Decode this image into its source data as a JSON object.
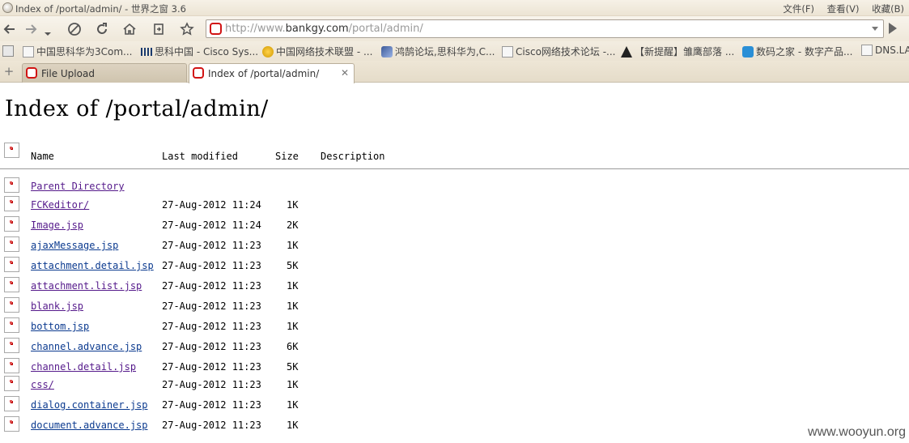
{
  "window": {
    "title": "Index of /portal/admin/ - 世界之窗 3.6",
    "menus": [
      "文件(F)",
      "查看(V)",
      "收藏(B)"
    ]
  },
  "toolbar": {
    "url_prefix": "http://www.",
    "url_domain": "bankgy.com",
    "url_path": "/portal/admin/"
  },
  "bookmarks": [
    {
      "label": "中国思科华为3Com...",
      "icon": "page"
    },
    {
      "label": "思科中国 - Cisco Sys...",
      "icon": "cisco"
    },
    {
      "label": "中国网络技术联盟 - ...",
      "icon": "trophy"
    },
    {
      "label": "鸿鹄论坛,思科华为,C...",
      "icon": "bird"
    },
    {
      "label": "Cisco网络技术论坛 -...",
      "icon": "page"
    },
    {
      "label": "【新提醒】雏鹰部落 ...",
      "icon": "boat"
    },
    {
      "label": "数码之家 - 数字产品...",
      "icon": "home"
    },
    {
      "label": "DNS.LA",
      "icon": "page"
    }
  ],
  "tabs": [
    {
      "label": "File Upload",
      "active": false
    },
    {
      "label": "Index of /portal/admin/",
      "active": true
    }
  ],
  "page": {
    "title": "Index of /portal/admin/",
    "columns": {
      "name": "Name",
      "modified": "Last modified",
      "size": "Size",
      "description": "Description"
    },
    "parent_label": "Parent Directory",
    "files": [
      {
        "name": "FCKeditor/",
        "modified": "27-Aug-2012 11:24",
        "size": "1K"
      },
      {
        "name": "Image.jsp",
        "modified": "27-Aug-2012 11:24",
        "size": "2K"
      },
      {
        "name": "ajaxMessage.jsp",
        "modified": "27-Aug-2012 11:23",
        "size": "1K"
      },
      {
        "name": "attachment.detail.jsp",
        "modified": "27-Aug-2012 11:23",
        "size": "5K"
      },
      {
        "name": "attachment.list.jsp",
        "modified": "27-Aug-2012 11:23",
        "size": "1K"
      },
      {
        "name": "blank.jsp",
        "modified": "27-Aug-2012 11:23",
        "size": "1K"
      },
      {
        "name": "bottom.jsp",
        "modified": "27-Aug-2012 11:23",
        "size": "1K"
      },
      {
        "name": "channel.advance.jsp",
        "modified": "27-Aug-2012 11:23",
        "size": "6K"
      },
      {
        "name": "channel.detail.jsp",
        "modified": "27-Aug-2012 11:23",
        "size": "5K"
      },
      {
        "name": "css/",
        "modified": "27-Aug-2012 11:23",
        "size": "1K"
      },
      {
        "name": "dialog.container.jsp",
        "modified": "27-Aug-2012 11:23",
        "size": "1K"
      },
      {
        "name": "document.advance.jsp",
        "modified": "27-Aug-2012 11:23",
        "size": "1K"
      }
    ]
  },
  "watermark": "www.wooyun.org"
}
